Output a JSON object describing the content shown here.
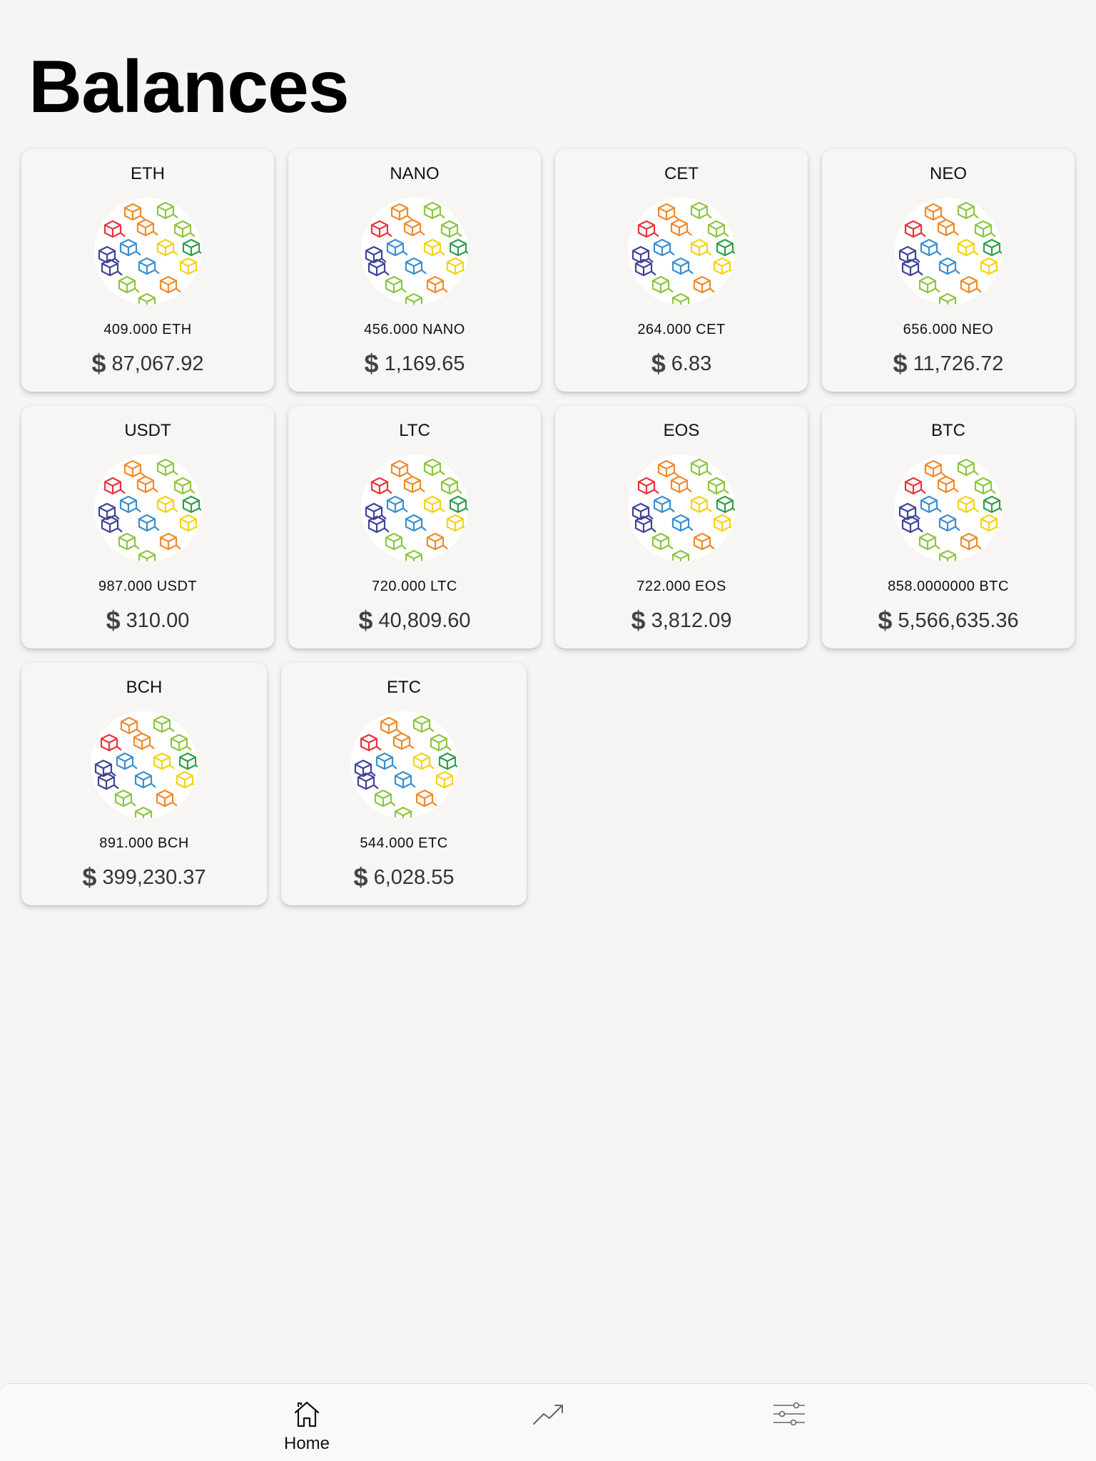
{
  "page": {
    "title": "Balances"
  },
  "currency_symbol": "$",
  "cards": [
    {
      "symbol": "ETH",
      "amount": "409.000 ETH",
      "value": "87,067.92"
    },
    {
      "symbol": "NANO",
      "amount": "456.000 NANO",
      "value": "1,169.65"
    },
    {
      "symbol": "CET",
      "amount": "264.000 CET",
      "value": "6.83"
    },
    {
      "symbol": "NEO",
      "amount": "656.000 NEO",
      "value": "11,726.72"
    },
    {
      "symbol": "USDT",
      "amount": "987.000 USDT",
      "value": "310.00"
    },
    {
      "symbol": "LTC",
      "amount": "720.000 LTC",
      "value": "40,809.60"
    },
    {
      "symbol": "EOS",
      "amount": "722.000 EOS",
      "value": "3,812.09"
    },
    {
      "symbol": "BTC",
      "amount": "858.0000000 BTC",
      "value": "5,566,635.36"
    },
    {
      "symbol": "BCH",
      "amount": "891.000 BCH",
      "value": "399,230.37"
    },
    {
      "symbol": "ETC",
      "amount": "544.000 ETC",
      "value": "6,028.55"
    }
  ],
  "coin_logo_icon": "blockchain-cubes-icon",
  "nav": {
    "items": [
      {
        "icon": "home-icon",
        "label": "Home",
        "active": true
      },
      {
        "icon": "trend-up-icon",
        "label": "",
        "active": false
      },
      {
        "icon": "sliders-icon",
        "label": "",
        "active": false
      }
    ]
  }
}
